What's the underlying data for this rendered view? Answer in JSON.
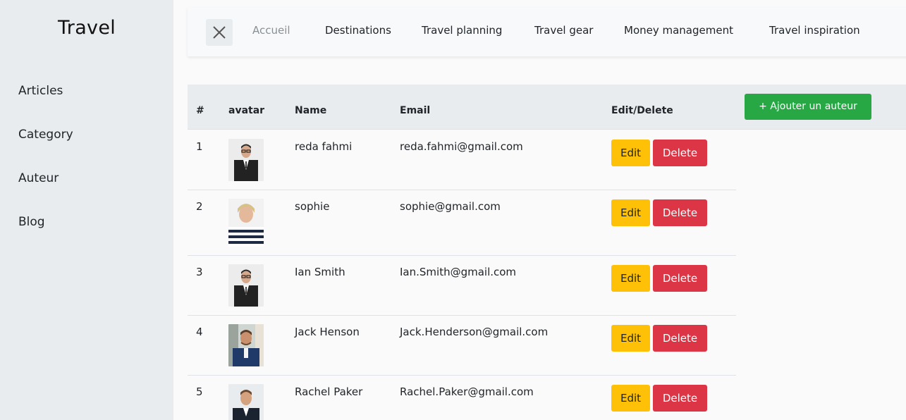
{
  "sidebar": {
    "brand": "Travel",
    "items": [
      {
        "label": "Articles"
      },
      {
        "label": "Category"
      },
      {
        "label": "Auteur"
      },
      {
        "label": "Blog"
      }
    ]
  },
  "topnav": {
    "links": [
      {
        "label": "Accueil"
      },
      {
        "label": "Destinations"
      },
      {
        "label": "Travel planning"
      },
      {
        "label": "Travel gear"
      },
      {
        "label": "Money management"
      },
      {
        "label": "Travel inspiration"
      }
    ]
  },
  "table": {
    "headers": [
      "#",
      "avatar",
      "Name",
      "Email",
      "Edit/Delete"
    ],
    "add_label": "+ Ajouter un auteur",
    "edit_label": "Edit",
    "delete_label": "Delete",
    "rows": [
      {
        "num": "1",
        "name": "reda fahmi",
        "email": "reda.fahmi@gmail.com"
      },
      {
        "num": "2",
        "name": "sophie",
        "email": "sophie@gmail.com"
      },
      {
        "num": "3",
        "name": "Ian Smith",
        "email": "Ian.Smith@gmail.com"
      },
      {
        "num": "4",
        "name": "Jack Henson",
        "email": "Jack.Henderson@gmail.com"
      },
      {
        "num": "5",
        "name": "Rachel Paker",
        "email": "Rachel.Paker@gmail.com"
      }
    ]
  },
  "colors": {
    "success": "#28a745",
    "warning": "#ffc107",
    "danger": "#dc3545",
    "sidebar_bg": "#e9ecef"
  }
}
